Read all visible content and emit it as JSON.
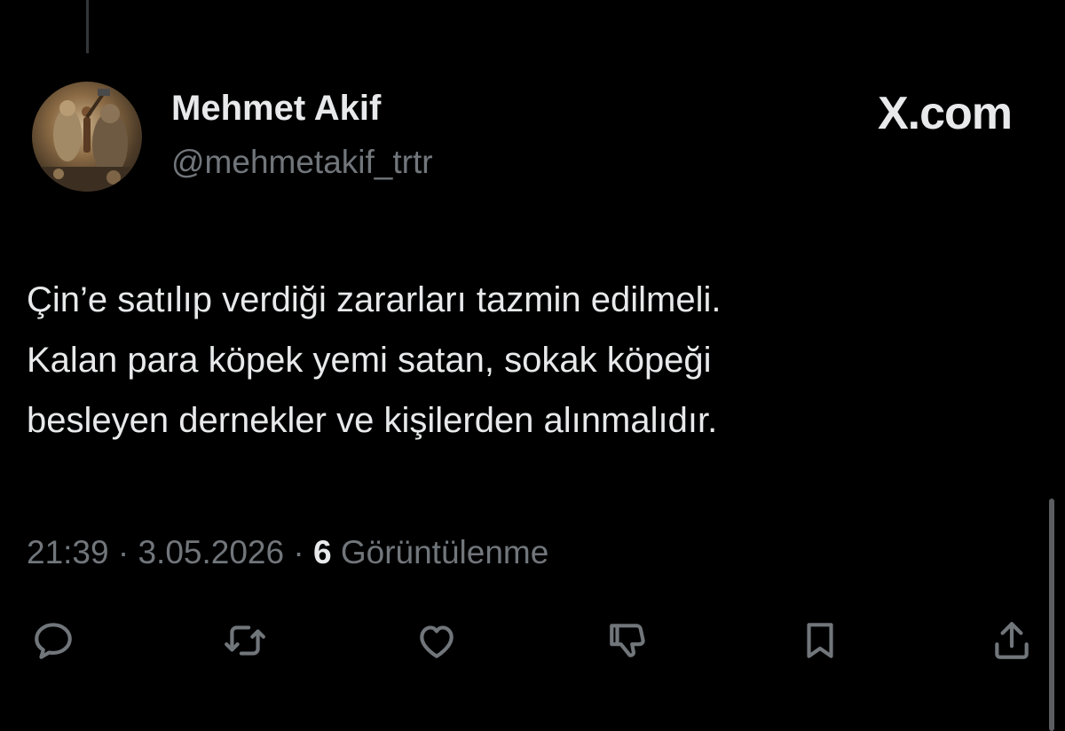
{
  "author": {
    "name": "Mehmet Akif",
    "handle": "@mehmetakif_trtr"
  },
  "brand": "X.com",
  "tweet": {
    "lines": [
      "Çin’e satılıp verdiği zararları tazmin edilmeli.",
      "Kalan para köpek yemi satan, sokak köpeği",
      "besleyen dernekler ve kişilerden alınmalıdır."
    ]
  },
  "meta": {
    "time": "21:39",
    "separator": "·",
    "date": "3.05.2026",
    "views_count": "6",
    "views_label": "Görüntülenme"
  },
  "actions": [
    {
      "icon": "reply-icon"
    },
    {
      "icon": "retweet-icon"
    },
    {
      "icon": "like-icon"
    },
    {
      "icon": "dislike-icon"
    },
    {
      "icon": "bookmark-icon"
    },
    {
      "icon": "share-icon"
    }
  ],
  "colors": {
    "background": "#000000",
    "primary_text": "#e7e9ea",
    "secondary_text": "#71767b"
  }
}
